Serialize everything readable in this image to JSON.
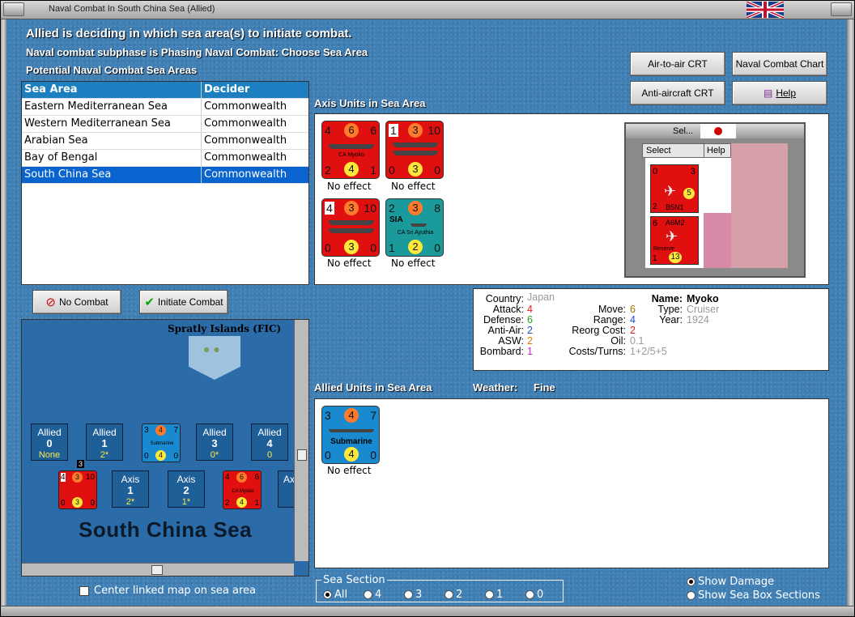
{
  "window": {
    "title": "Naval Combat In South China Sea (Allied)"
  },
  "header": {
    "line1": "Allied is deciding in which sea area(s) to initiate combat.",
    "line2": "Naval combat subphase is Phasing Naval Combat: Choose Sea Area",
    "line3": "Potential Naval Combat Sea Areas"
  },
  "buttons": {
    "air_crt": "Air-to-air CRT",
    "naval_chart": "Naval Combat Chart",
    "aa_crt": "Anti-aircraft CRT",
    "help": "Help",
    "no_combat": "No Combat",
    "initiate": "Initiate Combat"
  },
  "table": {
    "col1": "Sea Area",
    "col2": "Decider",
    "rows": [
      {
        "area": "Eastern Mediterranean Sea",
        "decider": "Commonwealth"
      },
      {
        "area": "Western Mediterranean Sea",
        "decider": "Commonwealth"
      },
      {
        "area": "Arabian Sea",
        "decider": "Commonwealth"
      },
      {
        "area": "Bay of Bengal",
        "decider": "Commonwealth"
      },
      {
        "area": "South China Sea",
        "decider": "Commonwealth"
      }
    ],
    "selected_index": 4
  },
  "axis": {
    "title": "Axis Units in Sea Area",
    "units": [
      {
        "tl": "4",
        "tc": "6",
        "tr": "6",
        "name": "CA Myoko",
        "bl": "2",
        "bc": "4",
        "br": "1",
        "status": "No effect"
      },
      {
        "tl": "1",
        "tc": "3",
        "tr": "10",
        "name": "",
        "bl": "0",
        "bc": "3",
        "br": "0",
        "status": "No effect"
      },
      {
        "tl": "4",
        "tc": "3",
        "tr": "10",
        "name": "",
        "bl": "0",
        "bc": "3",
        "br": "0",
        "status": "No effect"
      },
      {
        "tl": "2",
        "tc": "3",
        "tr": "8",
        "name": "CA Sri Ayuthia",
        "tag": "SIA",
        "bl": "1",
        "bc": "2",
        "br": "0",
        "status": "No effect"
      }
    ]
  },
  "carrier": {
    "title": "Sel...",
    "select": "Select",
    "help": "Help",
    "planes": [
      {
        "tl": "0",
        "tr": "3",
        "name": "B5N1",
        "bl": "2",
        "bc": "5"
      },
      {
        "tl": "6",
        "tr": "",
        "name": "A6M2",
        "sub": "Reserve",
        "bl": "1",
        "bc": "13"
      }
    ]
  },
  "info": {
    "country_l": "Country:",
    "country": "Japan",
    "attack_l": "Attack:",
    "attack": "4",
    "defense_l": "Defense:",
    "defense": "6",
    "aa_l": "Anti-Air:",
    "aa": "2",
    "asw_l": "ASW:",
    "asw": "2",
    "bombard_l": "Bombard:",
    "bombard": "1",
    "move_l": "Move:",
    "move": "6",
    "range_l": "Range:",
    "range": "4",
    "reorg_l": "Reorg Cost:",
    "reorg": "2",
    "oil_l": "Oil:",
    "oil": "0.1",
    "cost_l": "Costs/Turns:",
    "cost": "1+2/5+5",
    "name_l": "Name:",
    "name": "Myoko",
    "type_l": "Type:",
    "type": "Cruiser",
    "year_l": "Year:",
    "year": "1924"
  },
  "allied": {
    "title": "Allied Units in Sea Area",
    "weather_l": "Weather:",
    "weather": "Fine",
    "unit": {
      "tl": "3",
      "tc": "4",
      "tr": "7",
      "name": "Submarine",
      "bl": "0",
      "bc": "4",
      "br": "0",
      "status": "No effect"
    }
  },
  "map": {
    "island_label": "Spratly Islands (FIC)",
    "sea_name": "South China Sea",
    "allied_boxes": [
      {
        "t": "Allied",
        "n": "0",
        "s": "None"
      },
      {
        "t": "Allied",
        "n": "1",
        "s": "2*"
      },
      {
        "t": "Allied",
        "n": "3",
        "s": "0*"
      },
      {
        "t": "Allied",
        "n": "4",
        "s": "0"
      }
    ],
    "axis_boxes": [
      {
        "t": "Axis",
        "n": "1",
        "s": "2*"
      },
      {
        "t": "Axis",
        "n": "2",
        "s": "1*"
      },
      {
        "t": "Ax",
        "n": "",
        "s": ""
      }
    ],
    "sub": {
      "tl": "3",
      "tc": "4",
      "tr": "7",
      "name": "Submarine",
      "bl": "0",
      "bc": "4",
      "br": "0"
    },
    "red1": {
      "tl": "4",
      "tc": "3",
      "tr": "10",
      "bl": "0",
      "bc": "3",
      "br": "0",
      "badge": "3"
    },
    "red2": {
      "tl": "4",
      "tc": "6",
      "tr": "6",
      "name": "CA Myoko",
      "bl": "2",
      "bc": "4",
      "br": "1"
    }
  },
  "center_link": "Center linked map on sea area",
  "section": {
    "title": "Sea Section",
    "options": [
      "All",
      "4",
      "3",
      "2",
      "1",
      "0"
    ]
  },
  "show": {
    "damage": "Show Damage",
    "boxes": "Show Sea Box Sections"
  },
  "colors": {
    "axis_red": "#e01010",
    "siam_teal": "#1a9a9a",
    "allied_blue": "#1a8ad0"
  }
}
